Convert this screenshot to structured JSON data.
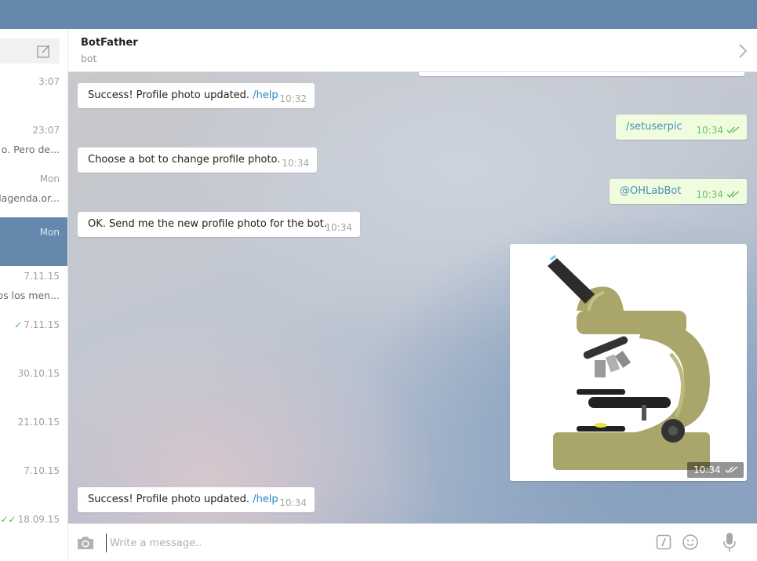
{
  "sidebar": {
    "items": [
      {
        "time": "3:07",
        "preview": "",
        "check": false,
        "active": false
      },
      {
        "time": "23:07",
        "preview": "o. Pero de...",
        "check": false,
        "active": false
      },
      {
        "time": "Mon",
        "preview": "lagenda.or...",
        "check": false,
        "active": false
      },
      {
        "time": "Mon",
        "preview": "",
        "check": false,
        "active": true
      },
      {
        "time": "7.11.15",
        "preview": "os los men...",
        "check": false,
        "active": false
      },
      {
        "time": "7.11.15",
        "preview": "",
        "check": true,
        "active": false
      },
      {
        "time": "30.10.15",
        "preview": "",
        "check": false,
        "active": false
      },
      {
        "time": "21.10.15",
        "preview": "",
        "check": false,
        "active": false
      },
      {
        "time": "7.10.15",
        "preview": "",
        "check": false,
        "active": false
      },
      {
        "time": "18.09.15",
        "preview": "",
        "check": true,
        "active": false
      }
    ]
  },
  "header": {
    "name": "BotFather",
    "status": "bot"
  },
  "messages": [
    {
      "text": "Success! Profile photo updated.",
      "link": "/help",
      "time": "10:32"
    },
    {
      "text": "/setuserpic",
      "time": "10:34"
    },
    {
      "text": "Choose a bot to change profile photo.",
      "time": "10:34"
    },
    {
      "text": "@OHLabBot",
      "time": "10:34"
    },
    {
      "text": "OK. Send me the new profile photo for the bot.",
      "time": "10:34"
    },
    {
      "image": "microscope",
      "time": "10:34"
    },
    {
      "text": "Success! Profile photo updated.",
      "link": "/help",
      "time": "10:34"
    }
  ],
  "input": {
    "placeholder": "Write a message.."
  },
  "colors": {
    "accent": "#6489ad",
    "outgoing": "#effdde",
    "link": "#2a87c2",
    "check": "#4dbb4d"
  },
  "icons": [
    "compose-icon",
    "chevron-right-icon",
    "camera-icon",
    "bot-command-icon",
    "emoji-icon",
    "microphone-icon",
    "double-check-icon"
  ]
}
